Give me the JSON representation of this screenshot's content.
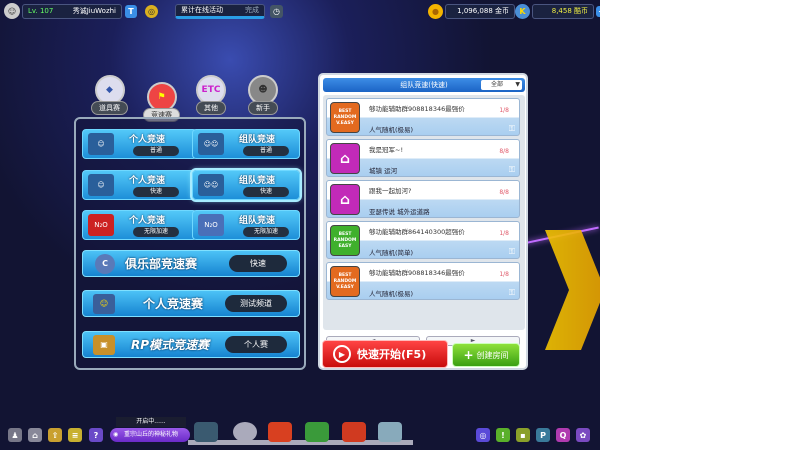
{
  "player": {
    "level": "Lv. 107",
    "name": "秀诚JiuWozhi",
    "badge": "T"
  },
  "event": {
    "label": "累计在线活动",
    "status": "完成"
  },
  "currency": {
    "gold": "1,096,088 金币",
    "kcoin": "8,458 酷币",
    "add": "+"
  },
  "categories": [
    {
      "label": "道具赛",
      "icon": "item-race-icon"
    },
    {
      "label": "竞速赛",
      "icon": "speed-race-icon",
      "active": true
    },
    {
      "label": "其他",
      "icon_text": "ETC"
    },
    {
      "label": "新手",
      "icon": "rookie-icon"
    }
  ],
  "modes": [
    {
      "title": "个人竞速",
      "sub": "普通"
    },
    {
      "title": "组队竞速",
      "sub": "普通"
    },
    {
      "title": "个人竞速",
      "sub": "快速"
    },
    {
      "title": "组队竞速",
      "sub": "快速",
      "selected": true
    },
    {
      "title": "个人竞速",
      "sub": "无限加速",
      "icon_text": "N₂O"
    },
    {
      "title": "组队竞速",
      "sub": "无限加速",
      "icon_text": "N₂O"
    }
  ],
  "big_modes": [
    {
      "title": "俱乐部竞速赛",
      "button": "快速"
    },
    {
      "title": "个人竞速赛",
      "button": "测试频道"
    },
    {
      "title": "RP模式竞速赛",
      "button": "个人赛"
    }
  ],
  "room_panel": {
    "title": "组队竞速(快速)",
    "filter": "全部",
    "prev": "◄",
    "next": "►",
    "rooms": [
      {
        "badge": "BEST RANDOM V.EASY",
        "color": "#e36a1f",
        "name": "够功能辅助群908818346最强价",
        "count": "1/8",
        "map": "人气随机(极易)",
        "locked": true
      },
      {
        "badge": "",
        "color": "#c22ab8",
        "name": "我是冠军~!",
        "count": "8/8",
        "map": "城镇 运河",
        "locked": true
      },
      {
        "badge": "",
        "color": "#c22ab8",
        "name": "跟我一起加河?",
        "count": "8/8",
        "map": "亚瑟传说 城外运道路",
        "locked": false
      },
      {
        "badge": "BEST RANDOM EASY",
        "color": "#3fb02c",
        "name": "够功能辅助群864140300超强价",
        "count": "1/8",
        "map": "人气随机(简单)",
        "locked": true
      },
      {
        "badge": "BEST RANDOM V.EASY",
        "color": "#e36a1f",
        "name": "够功能辅助群908818346最强价",
        "count": "1/8",
        "map": "人气随机(极易)",
        "locked": true
      }
    ]
  },
  "buttons": {
    "quick_start": "快速开始(F5)",
    "create_room": "创建房间"
  },
  "bottom": {
    "status": "开启中......",
    "gift": "重宗山丘的神秘礼物"
  },
  "colors": {
    "quick": "#e02020",
    "create": "#5cc01e",
    "header": "#2a75d6"
  }
}
